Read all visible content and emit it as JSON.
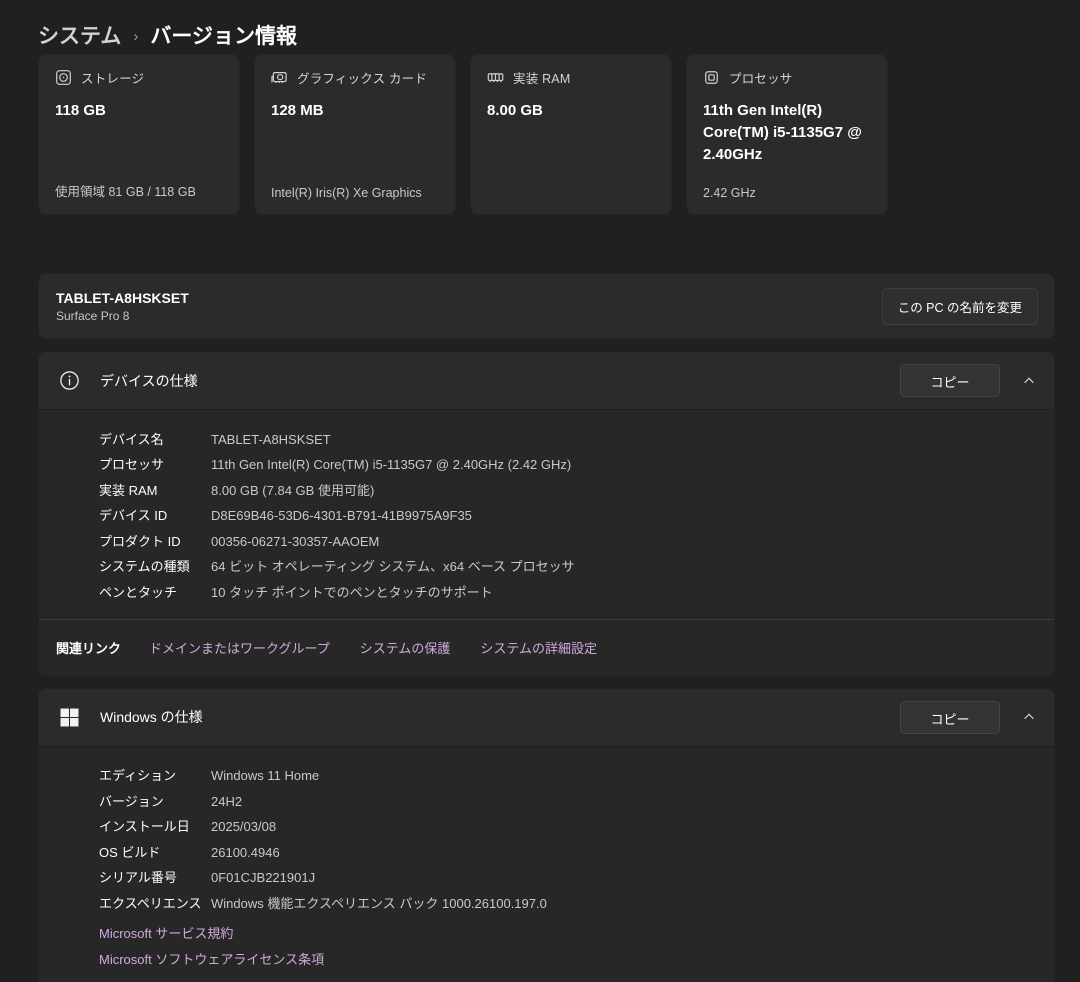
{
  "breadcrumb": {
    "parent": "システム",
    "separator": "›",
    "current": "バージョン情報"
  },
  "cards": [
    {
      "icon": "storage-icon",
      "label": "ストレージ",
      "value": "118 GB",
      "subtitle": "使用領域 81 GB / 118 GB"
    },
    {
      "icon": "graphics-card-icon",
      "label": "グラフィックス カード",
      "value": "128 MB",
      "subtitle": "Intel(R) Iris(R) Xe Graphics"
    },
    {
      "icon": "ram-icon",
      "label": "実装 RAM",
      "value": "8.00 GB",
      "subtitle": ""
    },
    {
      "icon": "cpu-icon",
      "label": "プロセッサ",
      "value": "11th Gen Intel(R) Core(TM) i5-1135G7 @ 2.40GHz",
      "subtitle": "2.42 GHz"
    }
  ],
  "device": {
    "name": "TABLET-A8HSKSET",
    "model": "Surface Pro 8",
    "rename_button": "この PC の名前を変更"
  },
  "device_specs": {
    "title": "デバイスの仕様",
    "copy_button": "コピー",
    "rows": [
      {
        "label": "デバイス名",
        "value": "TABLET-A8HSKSET"
      },
      {
        "label": "プロセッサ",
        "value": "11th Gen Intel(R) Core(TM) i5-1135G7 @ 2.40GHz (2.42 GHz)"
      },
      {
        "label": "実装 RAM",
        "value": "8.00 GB (7.84 GB 使用可能)"
      },
      {
        "label": "デバイス ID",
        "value": "D8E69B46-53D6-4301-B791-41B9975A9F35"
      },
      {
        "label": "プロダクト ID",
        "value": "00356-06271-30357-AAOEM"
      },
      {
        "label": "システムの種類",
        "value": "64 ビット オペレーティング システム、x64 ベース プロセッサ"
      },
      {
        "label": "ペンとタッチ",
        "value": "10 タッチ ポイントでのペンとタッチのサポート"
      }
    ],
    "related": {
      "label": "関連リンク",
      "links": [
        "ドメインまたはワークグループ",
        "システムの保護",
        "システムの詳細設定"
      ]
    }
  },
  "windows_specs": {
    "title": "Windows の仕様",
    "copy_button": "コピー",
    "rows": [
      {
        "label": "エディション",
        "value": "Windows 11 Home"
      },
      {
        "label": "バージョン",
        "value": "24H2"
      },
      {
        "label": "インストール日",
        "value": "2025/03/08"
      },
      {
        "label": "OS ビルド",
        "value": "26100.4946"
      },
      {
        "label": "シリアル番号",
        "value": "0F01CJB221901J"
      },
      {
        "label": "エクスペリエンス",
        "value": "Windows 機能エクスペリエンス パック 1000.26100.197.0"
      }
    ],
    "links": [
      "Microsoft サービス規約",
      "Microsoft ソフトウェアライセンス条項"
    ]
  },
  "colors": {
    "page_background": "#202020",
    "card_background": "#2b2b2b",
    "content_background": "#272727",
    "link": "#d0a9dd",
    "text_primary": "#ffffff",
    "text_secondary": "#c9c9c9"
  }
}
